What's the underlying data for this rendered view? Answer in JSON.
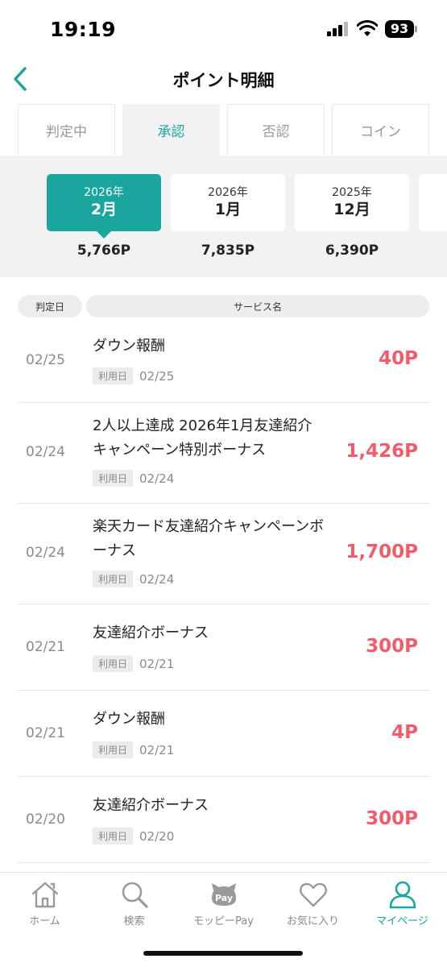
{
  "status_bar": {
    "time": "19:19",
    "battery": "93"
  },
  "header": {
    "title": "ポイント明細"
  },
  "tabs": [
    {
      "label": "判定中",
      "active": false
    },
    {
      "label": "承認",
      "active": true
    },
    {
      "label": "否認",
      "active": false
    },
    {
      "label": "コイン",
      "active": false
    }
  ],
  "months": [
    {
      "year": "2026年",
      "month": "2月",
      "total": "5,766P",
      "active": true
    },
    {
      "year": "2026年",
      "month": "1月",
      "total": "7,835P",
      "active": false
    },
    {
      "year": "2025年",
      "month": "12月",
      "total": "6,390P",
      "active": false
    }
  ],
  "columns": {
    "date": "判定日",
    "service": "サービス名"
  },
  "rows": [
    {
      "date": "02/25",
      "lines": [
        "ダウン報酬"
      ],
      "use_label": "利用日",
      "use_date": "02/25",
      "points": "40P"
    },
    {
      "date": "02/24",
      "lines": [
        "2人以上達成 2026年1月友達紹介",
        "キャンペーン特別ボーナス"
      ],
      "use_label": "利用日",
      "use_date": "02/24",
      "points": "1,426P"
    },
    {
      "date": "02/24",
      "lines": [
        "楽天カード友達紹介キャンペーンボ",
        "ーナス"
      ],
      "use_label": "利用日",
      "use_date": "02/24",
      "points": "1,700P"
    },
    {
      "date": "02/21",
      "lines": [
        "友達紹介ボーナス"
      ],
      "use_label": "利用日",
      "use_date": "02/21",
      "points": "300P"
    },
    {
      "date": "02/21",
      "lines": [
        "ダウン報酬"
      ],
      "use_label": "利用日",
      "use_date": "02/21",
      "points": "4P"
    },
    {
      "date": "02/20",
      "lines": [
        "友達紹介ボーナス"
      ],
      "use_label": "利用日",
      "use_date": "02/20",
      "points": "300P"
    }
  ],
  "tab_bar": [
    {
      "label": "ホーム",
      "icon": "home-icon"
    },
    {
      "label": "検索",
      "icon": "search-icon"
    },
    {
      "label": "モッピーPay",
      "icon": "moppy-pay-icon",
      "icon_text": "Pay"
    },
    {
      "label": "お気に入り",
      "icon": "heart-icon"
    },
    {
      "label": "マイページ",
      "icon": "person-icon",
      "active": true
    }
  ],
  "colors": {
    "accent": "#1aa69e",
    "points": "#f25c6a",
    "muted": "#8a8a8a"
  }
}
